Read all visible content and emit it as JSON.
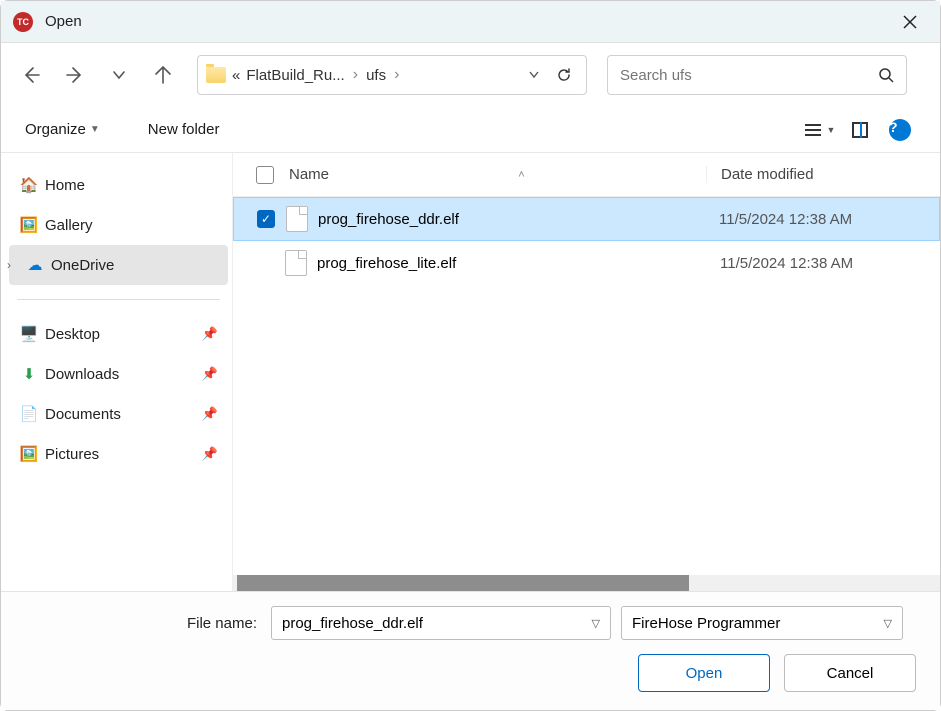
{
  "window": {
    "title": "Open"
  },
  "breadcrumb": {
    "prefix": "«",
    "folder": "FlatBuild_Ru...",
    "current": "ufs"
  },
  "search": {
    "placeholder": "Search ufs"
  },
  "toolbar": {
    "organize": "Organize",
    "newfolder": "New folder"
  },
  "sidebar": {
    "home": "Home",
    "gallery": "Gallery",
    "onedrive": "OneDrive",
    "desktop": "Desktop",
    "downloads": "Downloads",
    "documents": "Documents",
    "pictures": "Pictures"
  },
  "columns": {
    "name": "Name",
    "date": "Date modified"
  },
  "files": [
    {
      "name": "prog_firehose_ddr.elf",
      "date": "11/5/2024 12:38 AM",
      "selected": true
    },
    {
      "name": "prog_firehose_lite.elf",
      "date": "11/5/2024 12:38 AM",
      "selected": false
    }
  ],
  "footer": {
    "filename_label": "File name:",
    "filename_value": "prog_firehose_ddr.elf",
    "filter": "FireHose Programmer",
    "open": "Open",
    "cancel": "Cancel"
  }
}
